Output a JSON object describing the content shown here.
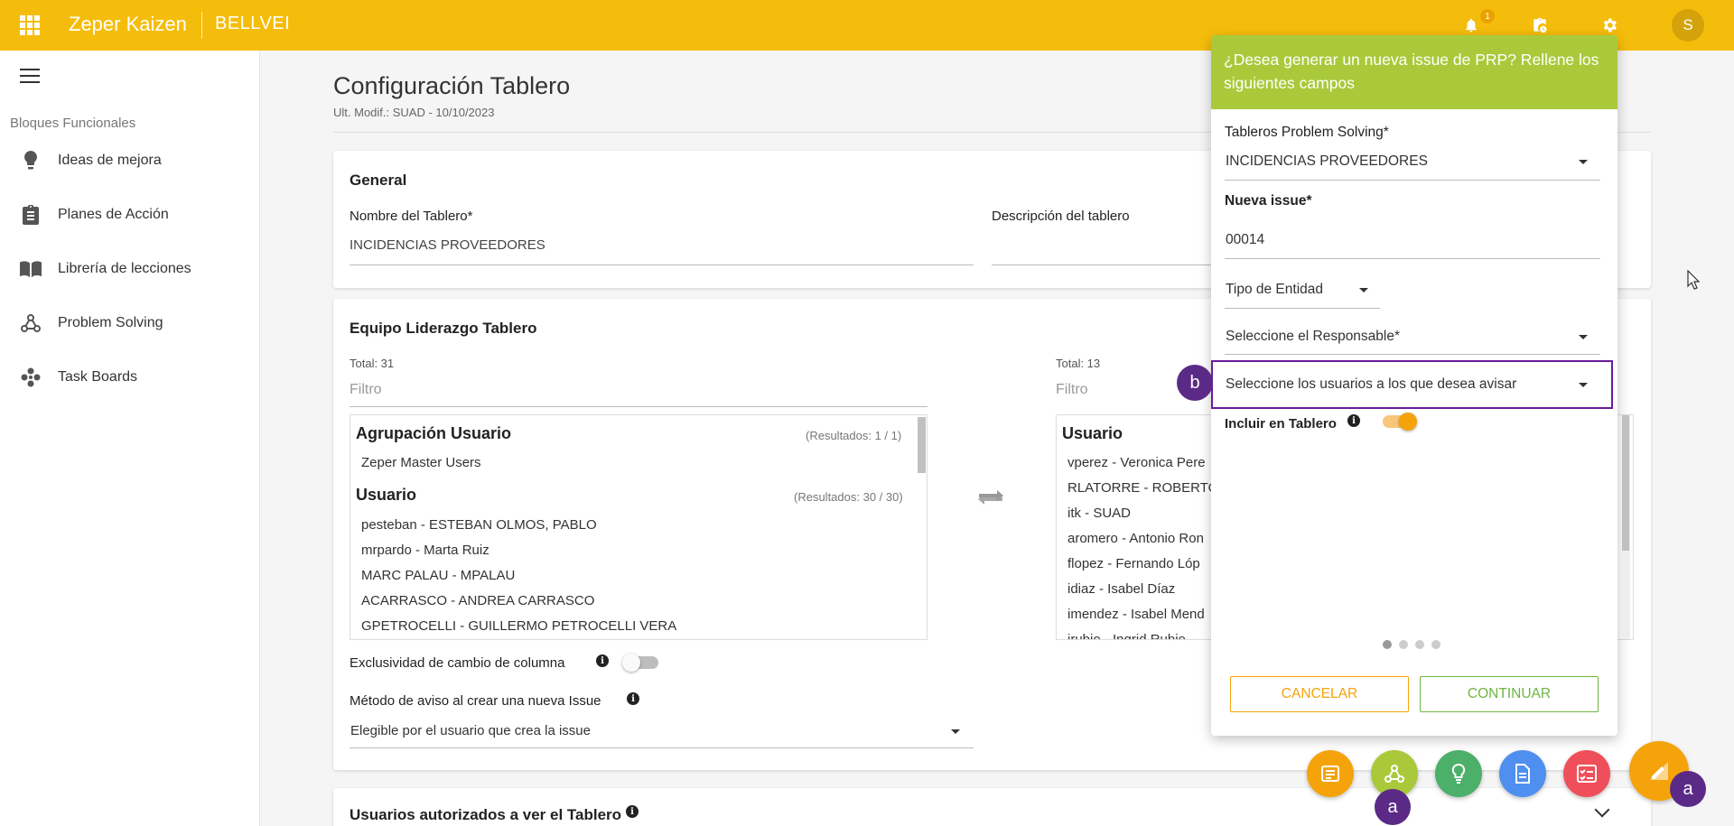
{
  "topbar": {
    "brand": "Zeper Kaizen",
    "company": "BELLVEI",
    "notification_count": "1"
  },
  "user": {
    "initial": "S"
  },
  "sidebar": {
    "section_title": "Bloques Funcionales",
    "items": [
      {
        "label": "Ideas de mejora",
        "icon": "lightbulb-icon"
      },
      {
        "label": "Planes de Acción",
        "icon": "clipboard-icon"
      },
      {
        "label": "Librería de lecciones",
        "icon": "book-icon"
      },
      {
        "label": "Problem Solving",
        "icon": "webhook-icon"
      },
      {
        "label": "Task Boards",
        "icon": "workspaces-icon"
      }
    ]
  },
  "page": {
    "title": "Configuración Tablero",
    "subtitle": "Ult. Modif.: SUAD - 10/10/2023"
  },
  "general": {
    "title": "General",
    "name_label": "Nombre del Tablero*",
    "name_value": "INCIDENCIAS PROVEEDORES",
    "desc_label": "Descripción del tablero"
  },
  "team": {
    "title": "Equipo Liderazgo Tablero",
    "left_total": "Total: 31",
    "left_filter": "Filtro",
    "right_total": "Total: 13",
    "right_filter": "Filtro",
    "group_header": "Agrupación Usuario",
    "group_count": "(Resultados: 1 / 1)",
    "group_items": [
      "Zeper Master Users"
    ],
    "user_header": "Usuario",
    "user_count": "(Resultados: 30 / 30)",
    "users": [
      "pesteban - ESTEBAN OLMOS, PABLO",
      "mrpardo - Marta Ruiz",
      "MARC PALAU - MPALAU",
      "ACARRASCO - ANDREA CARRASCO",
      "GPETROCELLI - GUILLERMO PETROCELLI VERA"
    ],
    "right_header": "Usuario",
    "right_users": [
      "vperez - Veronica Pere",
      "RLATORRE - ROBERTO",
      "itk - SUAD",
      "aromero - Antonio Ron",
      "flopez - Fernando Lóp",
      "idiaz - Isabel Díaz",
      "imendez - Isabel Mend",
      "irubio - Ingrid Rubio"
    ],
    "exclusive_label": "Exclusividad de cambio de columna",
    "exclusive_on": false,
    "notify_method_label": "Método de aviso al crear una nueva Issue",
    "notify_method_value": "Elegible por el usuario que crea la issue"
  },
  "authorized": {
    "title": "Usuarios autorizados a ver el Tablero"
  },
  "modal": {
    "header": "¿Desea generar un nueva issue de PRP? Rellene los siguientes campos",
    "boards_label": "Tableros Problem Solving*",
    "boards_value": "INCIDENCIAS PROVEEDORES",
    "issue_label": "Nueva issue*",
    "issue_value": "00014",
    "entity_placeholder": "Tipo de Entidad",
    "responsible_placeholder": "Seleccione el Responsable*",
    "notify_users_placeholder": "Seleccione los usuarios a los que desea avisar",
    "include_label": "Incluir en Tablero",
    "include_on": true,
    "cancel_label": "CANCELAR",
    "continue_label": "CONTINUAR",
    "step": "1 of 4"
  },
  "markers": {
    "b": "b",
    "a1": "a",
    "a2": "a"
  },
  "fab": [
    {
      "icon": "tablet-icon",
      "color": "#f5a30b"
    },
    {
      "icon": "webhook-icon",
      "color": "#a9c93a"
    },
    {
      "icon": "lightbulb-icon",
      "color": "#4caf6a"
    },
    {
      "icon": "document-icon",
      "color": "#4f8ff0"
    },
    {
      "icon": "checklist-icon",
      "color": "#ef4f5a"
    },
    {
      "icon": "edit-note-icon",
      "color": "#f5a30b"
    }
  ],
  "colors": {
    "topbar": "#f5bd0b",
    "modal_header": "#a9c93a",
    "accent_orange": "#f5a30b",
    "accent_green": "#6fb53f",
    "marker": "#5b2a86"
  }
}
